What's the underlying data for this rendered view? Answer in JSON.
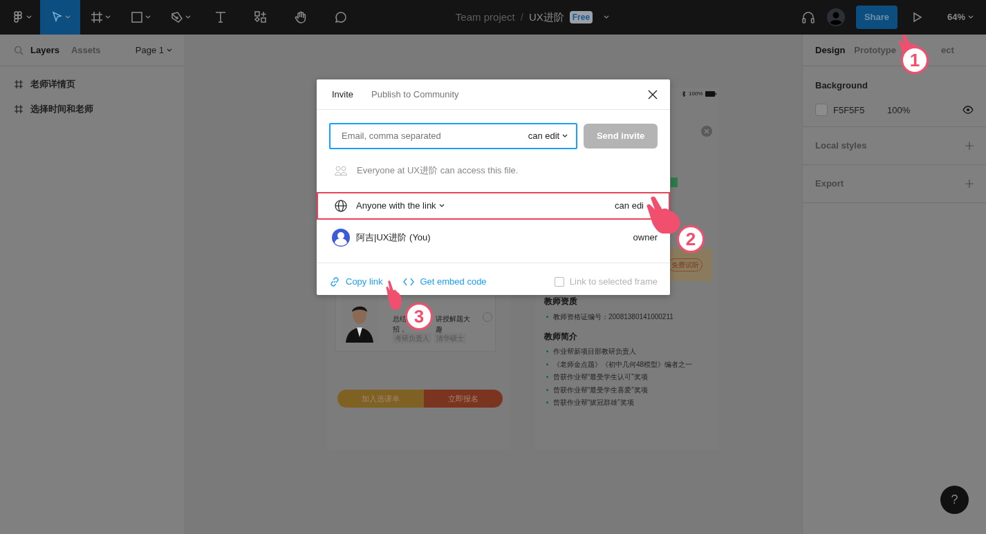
{
  "toolbar": {
    "tools": [
      {
        "kind": "main-menu",
        "caret": true,
        "selected": false
      },
      {
        "kind": "move",
        "caret": true,
        "selected": true
      },
      {
        "kind": "frame",
        "caret": true,
        "selected": false
      },
      {
        "kind": "shape",
        "caret": true,
        "selected": false
      },
      {
        "kind": "pen",
        "caret": true,
        "selected": false
      },
      {
        "kind": "text",
        "caret": false,
        "selected": false
      },
      {
        "kind": "resources",
        "caret": false,
        "selected": false
      },
      {
        "kind": "hand",
        "caret": false,
        "selected": false
      },
      {
        "kind": "comment",
        "caret": false,
        "selected": false
      }
    ],
    "file": {
      "project": "Team project",
      "separator": "/",
      "name": "UX进阶",
      "plan": "Free"
    },
    "share": "Share",
    "zoom": "64%"
  },
  "left_panel": {
    "tabs": [
      {
        "label": "Layers",
        "selected": true
      },
      {
        "label": "Assets",
        "selected": false
      }
    ],
    "page": "Page 1",
    "layers": [
      "老师详情页",
      "选择时间和老师"
    ]
  },
  "canvas": {
    "left_frame": {
      "card": {
        "description": [
          "总结",
          "讲授解题大",
          "招，",
          "趣"
        ],
        "tags": [
          "考研负责人",
          "清华硕士"
        ],
        "selected": false
      },
      "buttons": [
        "加入选课单",
        "立即报名"
      ]
    },
    "right_frame": {
      "battery": "100%",
      "trial_button": "免费试听",
      "sections": [
        {
          "title": "教师资质",
          "items": [
            "教师资格证编号：20081380141000211"
          ]
        },
        {
          "title": "教师简介",
          "items": [
            "作业帮新项目部教研负责人",
            "《老师金点题》《初中几何48模型》编者之一",
            "曾获作业帮“最受学生认可”奖项",
            "曾获作业帮“最受学生喜爱”奖项",
            "曾获作业帮“拔冠群雄”奖项"
          ]
        }
      ]
    }
  },
  "right_panel": {
    "tabs": [
      {
        "label": "Design",
        "selected": true
      },
      {
        "label": "Prototype",
        "selected": false
      },
      {
        "label": "ect",
        "selected": false
      }
    ],
    "background": {
      "title": "Background",
      "hex": "F5F5F5",
      "opacity": "100%"
    },
    "sections": [
      "Local styles",
      "Export"
    ]
  },
  "dialog": {
    "tabs": [
      {
        "label": "Invite",
        "selected": true
      },
      {
        "label": "Publish to Community",
        "selected": false
      }
    ],
    "email": {
      "placeholder": "Email, comma separated",
      "permission": "can edit"
    },
    "send": {
      "label": "Send invite",
      "disabled": true
    },
    "notice": "Everyone at UX进阶 can access this file.",
    "link_access": {
      "label": "Anyone with the link",
      "permission": "can edi",
      "highlighted": true
    },
    "members": [
      {
        "name": "阿吉|UX进阶 (You)",
        "role": "owner"
      }
    ],
    "footer": {
      "copy_link": "Copy link",
      "embed": "Get embed code",
      "frame_link": {
        "label": "Link to selected frame",
        "checked": false
      }
    }
  },
  "annotations": {
    "steps": [
      "1",
      "2",
      "3"
    ]
  },
  "help": "?"
}
